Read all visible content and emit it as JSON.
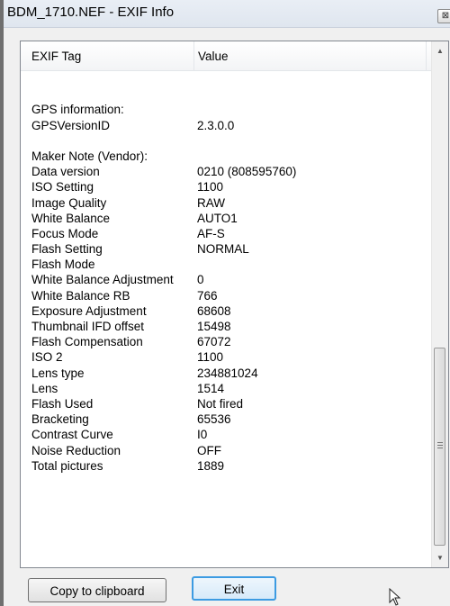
{
  "window": {
    "title": "BDM_1710.NEF - EXIF Info",
    "close_glyph": "⊠"
  },
  "list": {
    "columns": [
      "EXIF Tag",
      "Value"
    ],
    "rows": [
      {
        "tag": "",
        "value": ""
      },
      {
        "tag": "",
        "value": ""
      },
      {
        "tag": "GPS information:",
        "value": ""
      },
      {
        "tag": "GPSVersionID",
        "value": "2.3.0.0"
      },
      {
        "tag": "",
        "value": ""
      },
      {
        "tag": "Maker Note (Vendor):",
        "value": ""
      },
      {
        "tag": "Data version",
        "value": "0210 (808595760)"
      },
      {
        "tag": "ISO Setting",
        "value": "1100"
      },
      {
        "tag": "Image Quality",
        "value": "RAW"
      },
      {
        "tag": "White Balance",
        "value": "AUTO1"
      },
      {
        "tag": "Focus Mode",
        "value": "AF-S"
      },
      {
        "tag": "Flash Setting",
        "value": "NORMAL"
      },
      {
        "tag": "Flash Mode",
        "value": ""
      },
      {
        "tag": "White Balance Adjustment",
        "value": "0"
      },
      {
        "tag": "White Balance RB",
        "value": "766"
      },
      {
        "tag": "Exposure Adjustment",
        "value": "68608"
      },
      {
        "tag": "Thumbnail IFD offset",
        "value": "15498"
      },
      {
        "tag": "Flash Compensation",
        "value": "67072"
      },
      {
        "tag": "ISO 2",
        "value": "1100"
      },
      {
        "tag": "Lens type",
        "value": "234881024"
      },
      {
        "tag": "Lens",
        "value": "1514"
      },
      {
        "tag": "Flash Used",
        "value": "Not fired"
      },
      {
        "tag": "Bracketing",
        "value": "65536"
      },
      {
        "tag": "Contrast Curve",
        "value": "I0"
      },
      {
        "tag": "Noise Reduction",
        "value": "OFF"
      },
      {
        "tag": "Total pictures",
        "value": "1889"
      }
    ]
  },
  "scrollbar": {
    "up_glyph": "▲",
    "down_glyph": "▼"
  },
  "buttons": {
    "copy_label": "Copy to clipboard",
    "exit_label": "Exit"
  }
}
